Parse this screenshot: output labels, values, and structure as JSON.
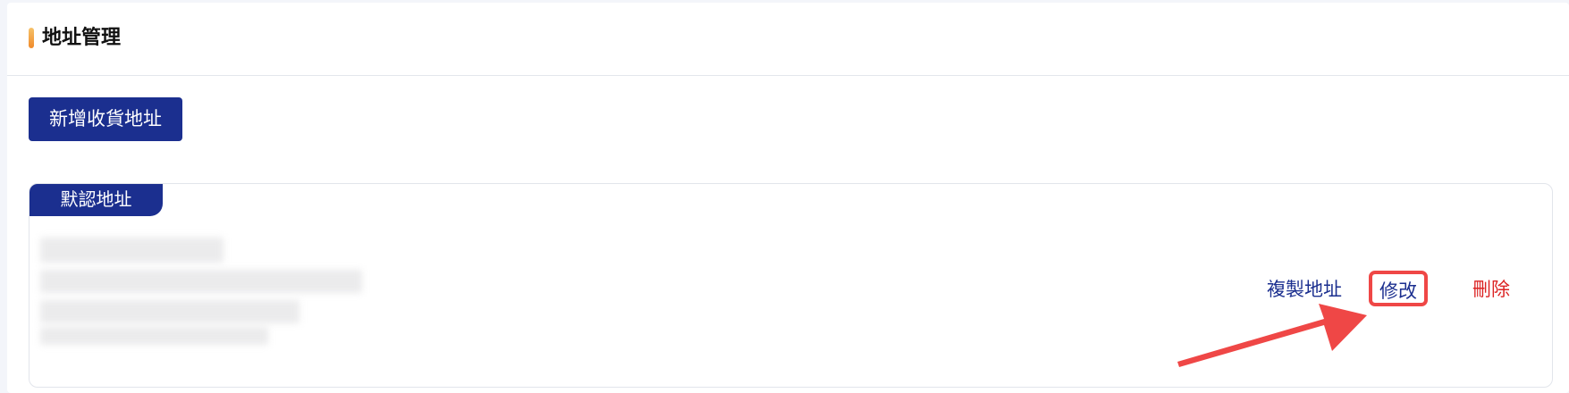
{
  "page": {
    "title": "地址管理"
  },
  "toolbar": {
    "add_label": "新增收貨地址"
  },
  "address_card": {
    "default_tag": "默認地址",
    "actions": {
      "copy": "複製地址",
      "edit": "修改",
      "delete": "刪除"
    }
  },
  "colors": {
    "primary": "#1b2f8f",
    "danger": "#dc2424",
    "highlight": "#ef4746",
    "accent_bar": "#f08a2a"
  }
}
